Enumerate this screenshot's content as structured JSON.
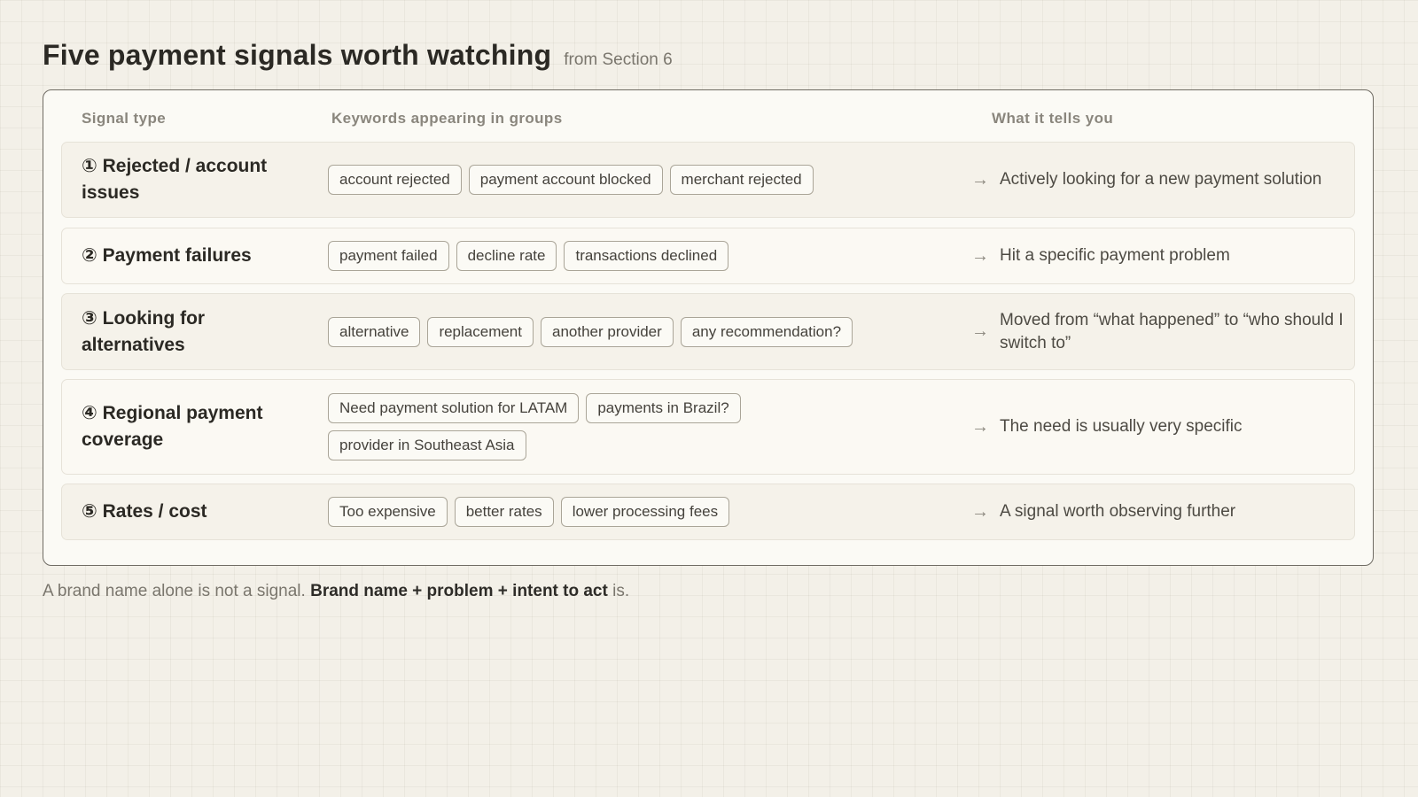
{
  "title": "Five payment signals worth watching",
  "subtitle": "from Section 6",
  "table": {
    "headers": {
      "signal": "Signal type",
      "keywords": "Keywords appearing in groups",
      "tells": "What it tells you"
    },
    "arrow_icon": "→",
    "rows": [
      {
        "signal": "① Rejected / account issues",
        "keywords": [
          "account rejected",
          "payment account blocked",
          "merchant rejected"
        ],
        "tells": "Actively looking for a new payment solution"
      },
      {
        "signal": "② Payment failures",
        "keywords": [
          "payment failed",
          "decline rate",
          "transactions declined"
        ],
        "tells": "Hit a specific payment problem"
      },
      {
        "signal": "③ Looking for alternatives",
        "keywords": [
          "alternative",
          "replacement",
          "another provider",
          "any recommendation?"
        ],
        "tells": "Moved from “what happened” to “who should I switch to”"
      },
      {
        "signal": "④ Regional payment coverage",
        "keywords": [
          "Need payment solution for LATAM",
          "payments in Brazil?",
          "provider in Southeast Asia"
        ],
        "tells": "The need is usually very specific"
      },
      {
        "signal": "⑤ Rates / cost",
        "keywords": [
          "Too expensive",
          "better rates",
          "lower processing fees"
        ],
        "tells": "A signal worth observing further"
      }
    ]
  },
  "footnote": {
    "lead": "A brand name alone is not a signal.",
    "emphasis": "Brand name + problem + intent to act",
    "tail": "is."
  },
  "colors": {
    "background": "#f3f0e8",
    "panel": "#fbfaf5",
    "row_alt": "#f5f2ea",
    "chip_border": "#aaa598",
    "muted_text": "#7a766d"
  }
}
